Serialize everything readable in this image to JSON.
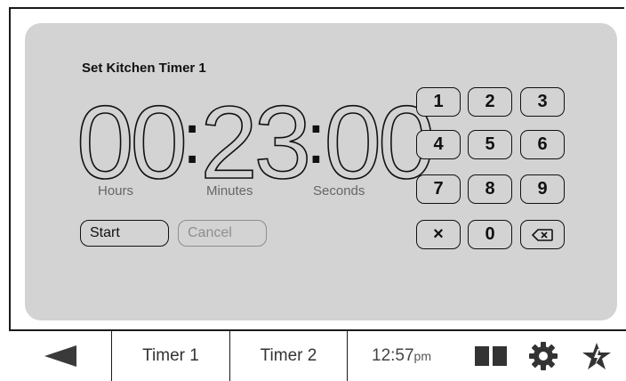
{
  "timer": {
    "title": "Set Kitchen Timer 1",
    "hours": "00",
    "minutes": "23",
    "seconds": "00",
    "separator": ":",
    "labels": {
      "hours": "Hours",
      "minutes": "Minutes",
      "seconds": "Seconds"
    },
    "start_label": "Start",
    "cancel_label": "Cancel"
  },
  "keypad": {
    "keys": [
      "1",
      "2",
      "3",
      "4",
      "5",
      "6",
      "7",
      "8",
      "9",
      "×",
      "0",
      "backspace-icon"
    ],
    "digits": {
      "k1": "1",
      "k2": "2",
      "k3": "3",
      "k4": "4",
      "k5": "5",
      "k6": "6",
      "k7": "7",
      "k8": "8",
      "k9": "9",
      "k0": "0",
      "clear": "×"
    }
  },
  "bottom_bar": {
    "back_icon": "back-arrow-icon",
    "tabs": [
      "Timer 1",
      "Timer 2"
    ],
    "tab1": "Timer 1",
    "tab2": "Timer 2",
    "time": "12:57",
    "ampm": "pm",
    "icons": [
      "layout-panels-icon",
      "gear-icon",
      "favorite-star-icon"
    ]
  },
  "colors": {
    "panel": "#d3d3d3",
    "text": "#111111",
    "muted": "#8e8e8e"
  }
}
